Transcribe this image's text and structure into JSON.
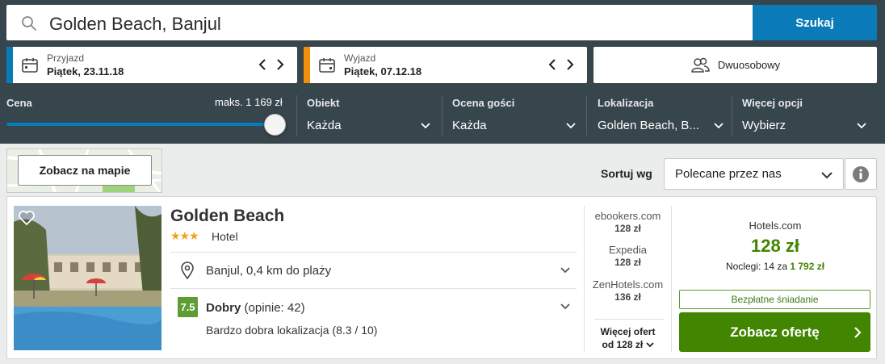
{
  "search": {
    "query": "Golden Beach, Banjul",
    "button_label": "Szukaj",
    "icon": "search-icon"
  },
  "checkin": {
    "label": "Przyjazd",
    "value": "Piątek, 23.11.18",
    "accent_color": "#0a7ab8"
  },
  "checkout": {
    "label": "Wyjazd",
    "value": "Piątek, 07.12.18",
    "accent_color": "#f0900a"
  },
  "guests": {
    "label": "Dwuosobowy",
    "icon": "guests-icon"
  },
  "filters": {
    "price": {
      "label": "Cena",
      "max_label": "maks. 1 169 zł",
      "slider_fraction": 1.0
    },
    "property": {
      "label": "Obiekt",
      "value": "Każda"
    },
    "rating": {
      "label": "Ocena gości",
      "value": "Każda"
    },
    "location": {
      "label": "Lokalizacja",
      "value": "Golden Beach, B..."
    },
    "more": {
      "label": "Więcej opcji",
      "value": "Wybierz"
    }
  },
  "map": {
    "button_label": "Zobacz na mapie"
  },
  "sort": {
    "label": "Sortuj wg",
    "value": "Polecane przez nas"
  },
  "hotel": {
    "name": "Golden Beach",
    "stars": "★★★",
    "star_count": 3,
    "type": "Hotel",
    "location": "Banjul, 0,4 km do plaży",
    "rating_score": "7.5",
    "rating_word": "Dobry",
    "rating_count": "(opinie: 42)",
    "rating_detail": "Bardzo dobra lokalizacja (8.3 / 10)",
    "providers": [
      {
        "name": "ebookers.com",
        "price": "128 zł"
      },
      {
        "name": "Expedia",
        "price": "128 zł"
      },
      {
        "name": "ZenHotels.com",
        "price": "136 zł"
      }
    ],
    "more_offers_line1": "Więcej ofert",
    "more_offers_line2": "od 128 zł",
    "best": {
      "provider": "Hotels.com",
      "price": "128 zł",
      "nights_prefix": "Noclegi: 14 za",
      "nights_total": "1 792 zł",
      "badge": "Bezpłatne śniadanie",
      "button_label": "Zobacz ofertę"
    }
  },
  "colors": {
    "header_bg": "#37454d",
    "accent_blue": "#0a7ab8",
    "deal_green": "#428500",
    "rating_green": "#5e9c34"
  }
}
